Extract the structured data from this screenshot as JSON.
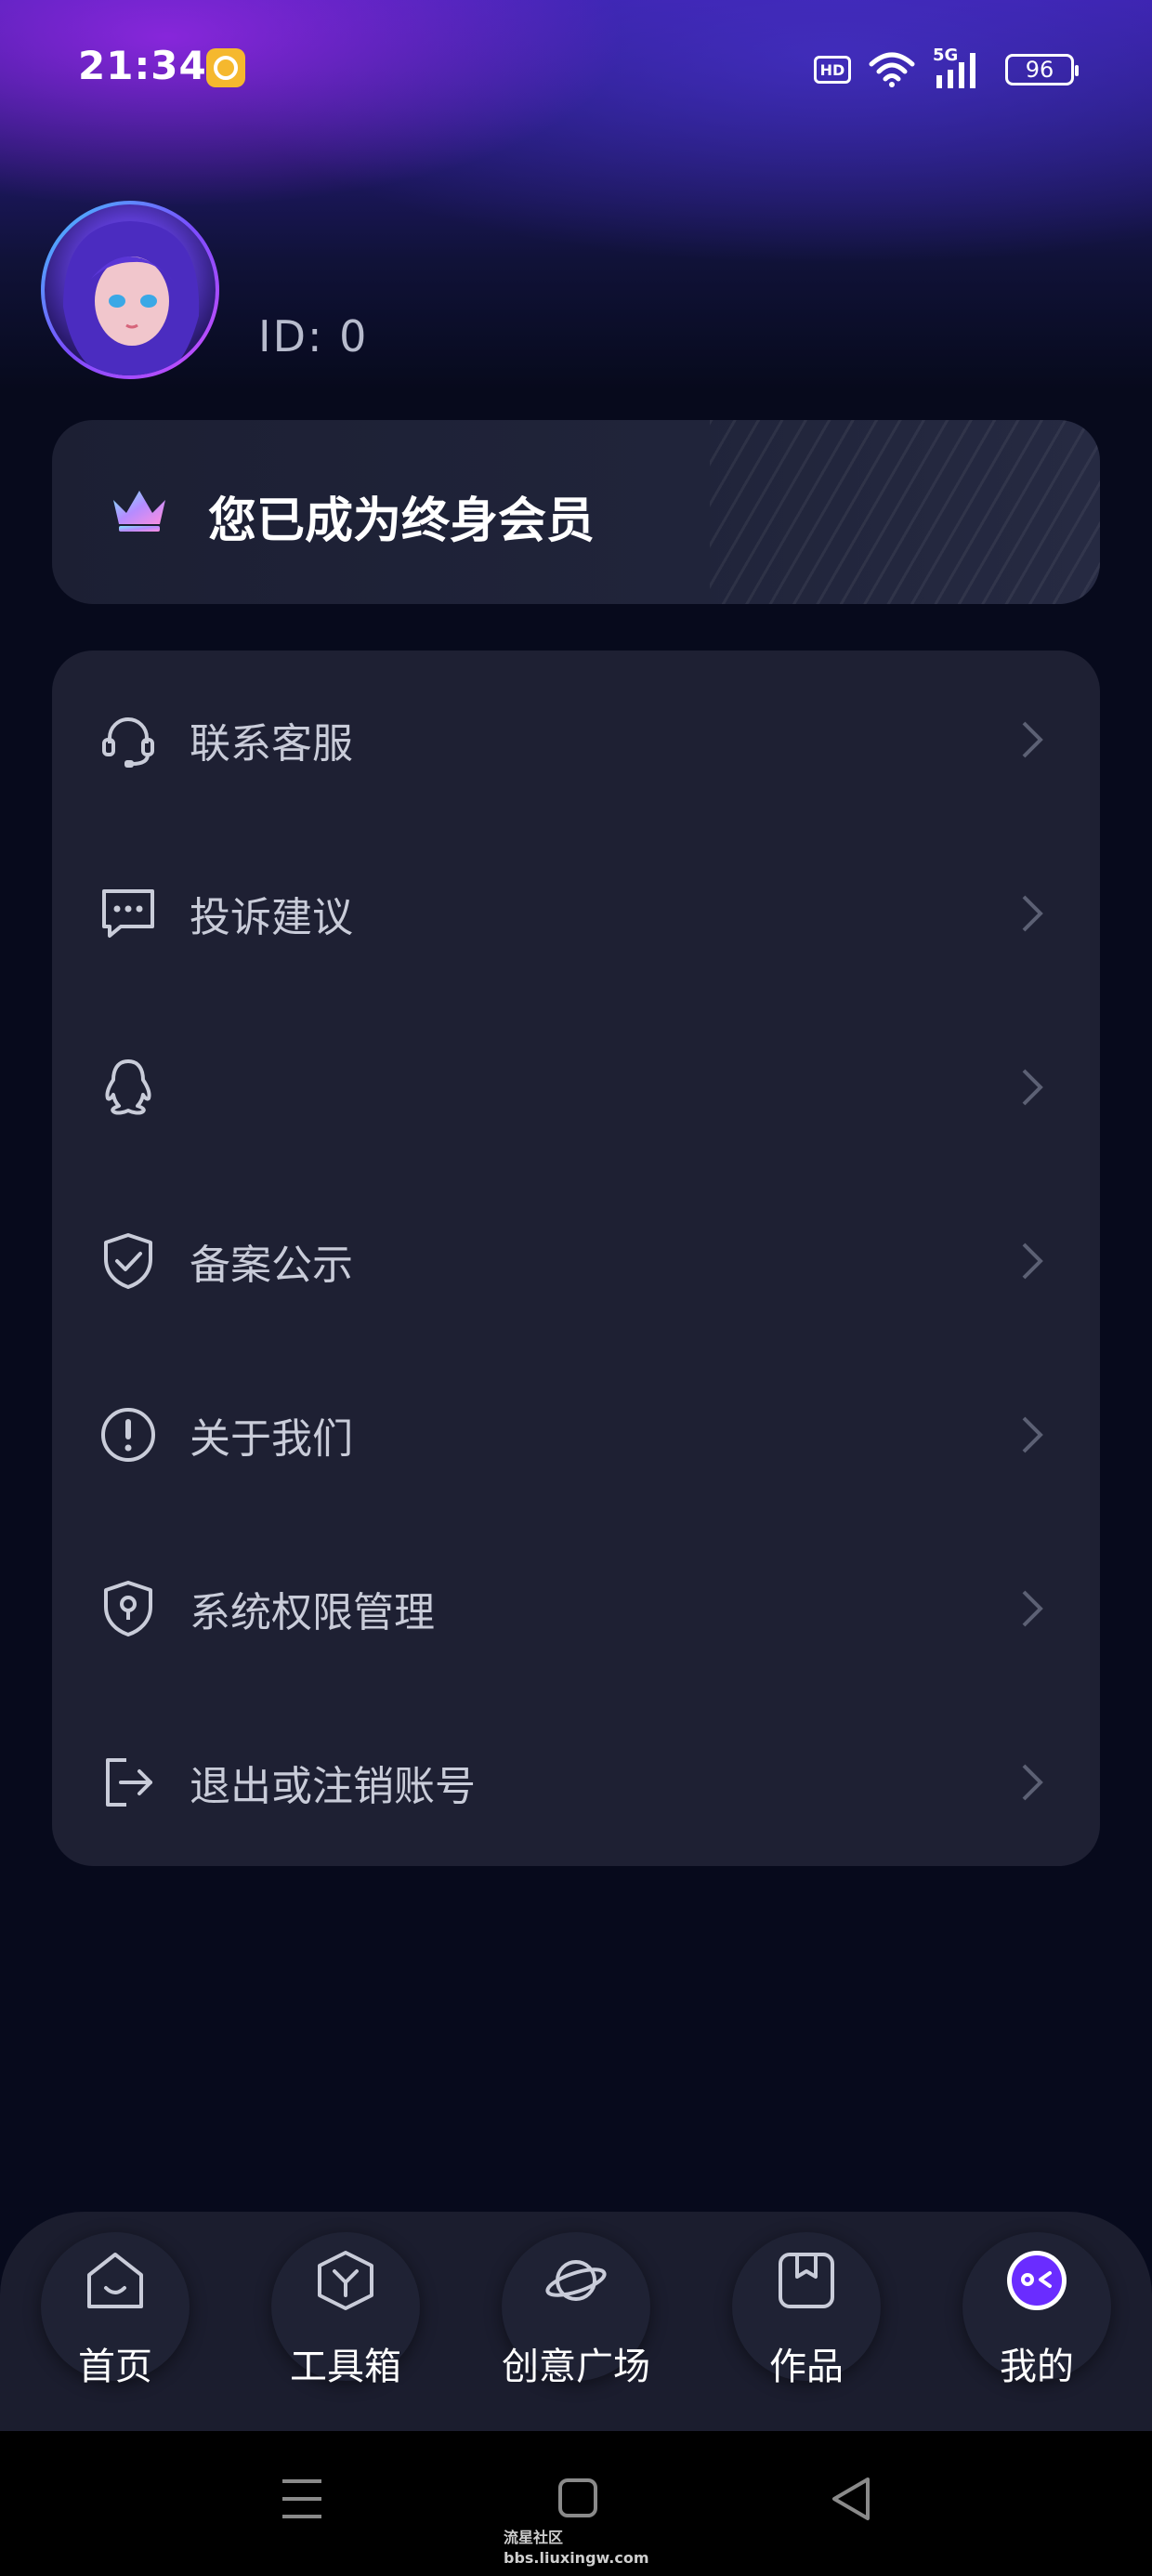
{
  "status_bar": {
    "time": "21:34",
    "hd": "HD",
    "network": "5G",
    "battery": "96"
  },
  "profile": {
    "id_text": "ID:  0"
  },
  "vip": {
    "text": "您已成为终身会员"
  },
  "menu": {
    "items": [
      {
        "label": "联系客服",
        "icon": "headset-icon"
      },
      {
        "label": "投诉建议",
        "icon": "message-dots-icon"
      },
      {
        "label": "",
        "icon": "qq-penguin-icon"
      },
      {
        "label": "备案公示",
        "icon": "shield-check-icon"
      },
      {
        "label": "关于我们",
        "icon": "exclamation-circle-icon"
      },
      {
        "label": "系统权限管理",
        "icon": "shield-lock-icon"
      },
      {
        "label": "退出或注销账号",
        "icon": "logout-icon"
      }
    ]
  },
  "bottom_nav": {
    "items": [
      {
        "label": "首页",
        "icon": "home-icon"
      },
      {
        "label": "工具箱",
        "icon": "toolbox-icon"
      },
      {
        "label": "创意广场",
        "icon": "planet-icon"
      },
      {
        "label": "作品",
        "icon": "bookmark-box-icon"
      },
      {
        "label": "我的",
        "icon": "profile-face-icon",
        "active": true
      }
    ]
  },
  "watermark": {
    "line1": "流星社区",
    "line2": "bbs.liuxingw.com"
  },
  "colors": {
    "background": "#070a1c",
    "card": "#1e2033",
    "accent": "#6a2cff",
    "text_muted": "#c9ccd9"
  }
}
